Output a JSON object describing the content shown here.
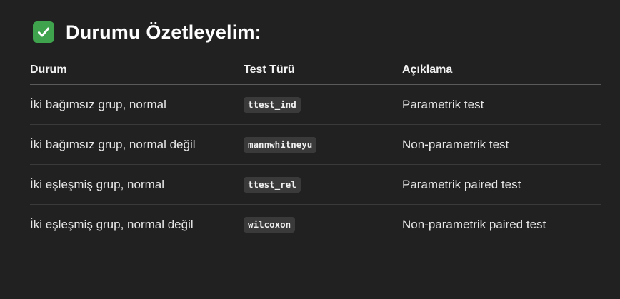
{
  "heading": {
    "icon": "white-check-mark-icon",
    "text": "Durumu Özetleyelim:"
  },
  "table": {
    "headers": [
      "Durum",
      "Test Türü",
      "Açıklama"
    ],
    "rows": [
      {
        "durum": "İki bağımsız grup, normal",
        "test": "ttest_ind",
        "aciklama": "Parametrik test"
      },
      {
        "durum": "İki bağımsız grup, normal değil",
        "test": "mannwhitneyu",
        "aciklama": "Non-parametrik test"
      },
      {
        "durum": "İki eşleşmiş grup, normal",
        "test": "ttest_rel",
        "aciklama": "Parametrik paired test"
      },
      {
        "durum": "İki eşleşmiş grup, normal değil",
        "test": "wilcoxon",
        "aciklama": "Non-parametrik paired test"
      }
    ]
  },
  "colors": {
    "background": "#212121",
    "check_icon_bg": "#3fa34d",
    "code_bg": "#3a3a3a"
  }
}
